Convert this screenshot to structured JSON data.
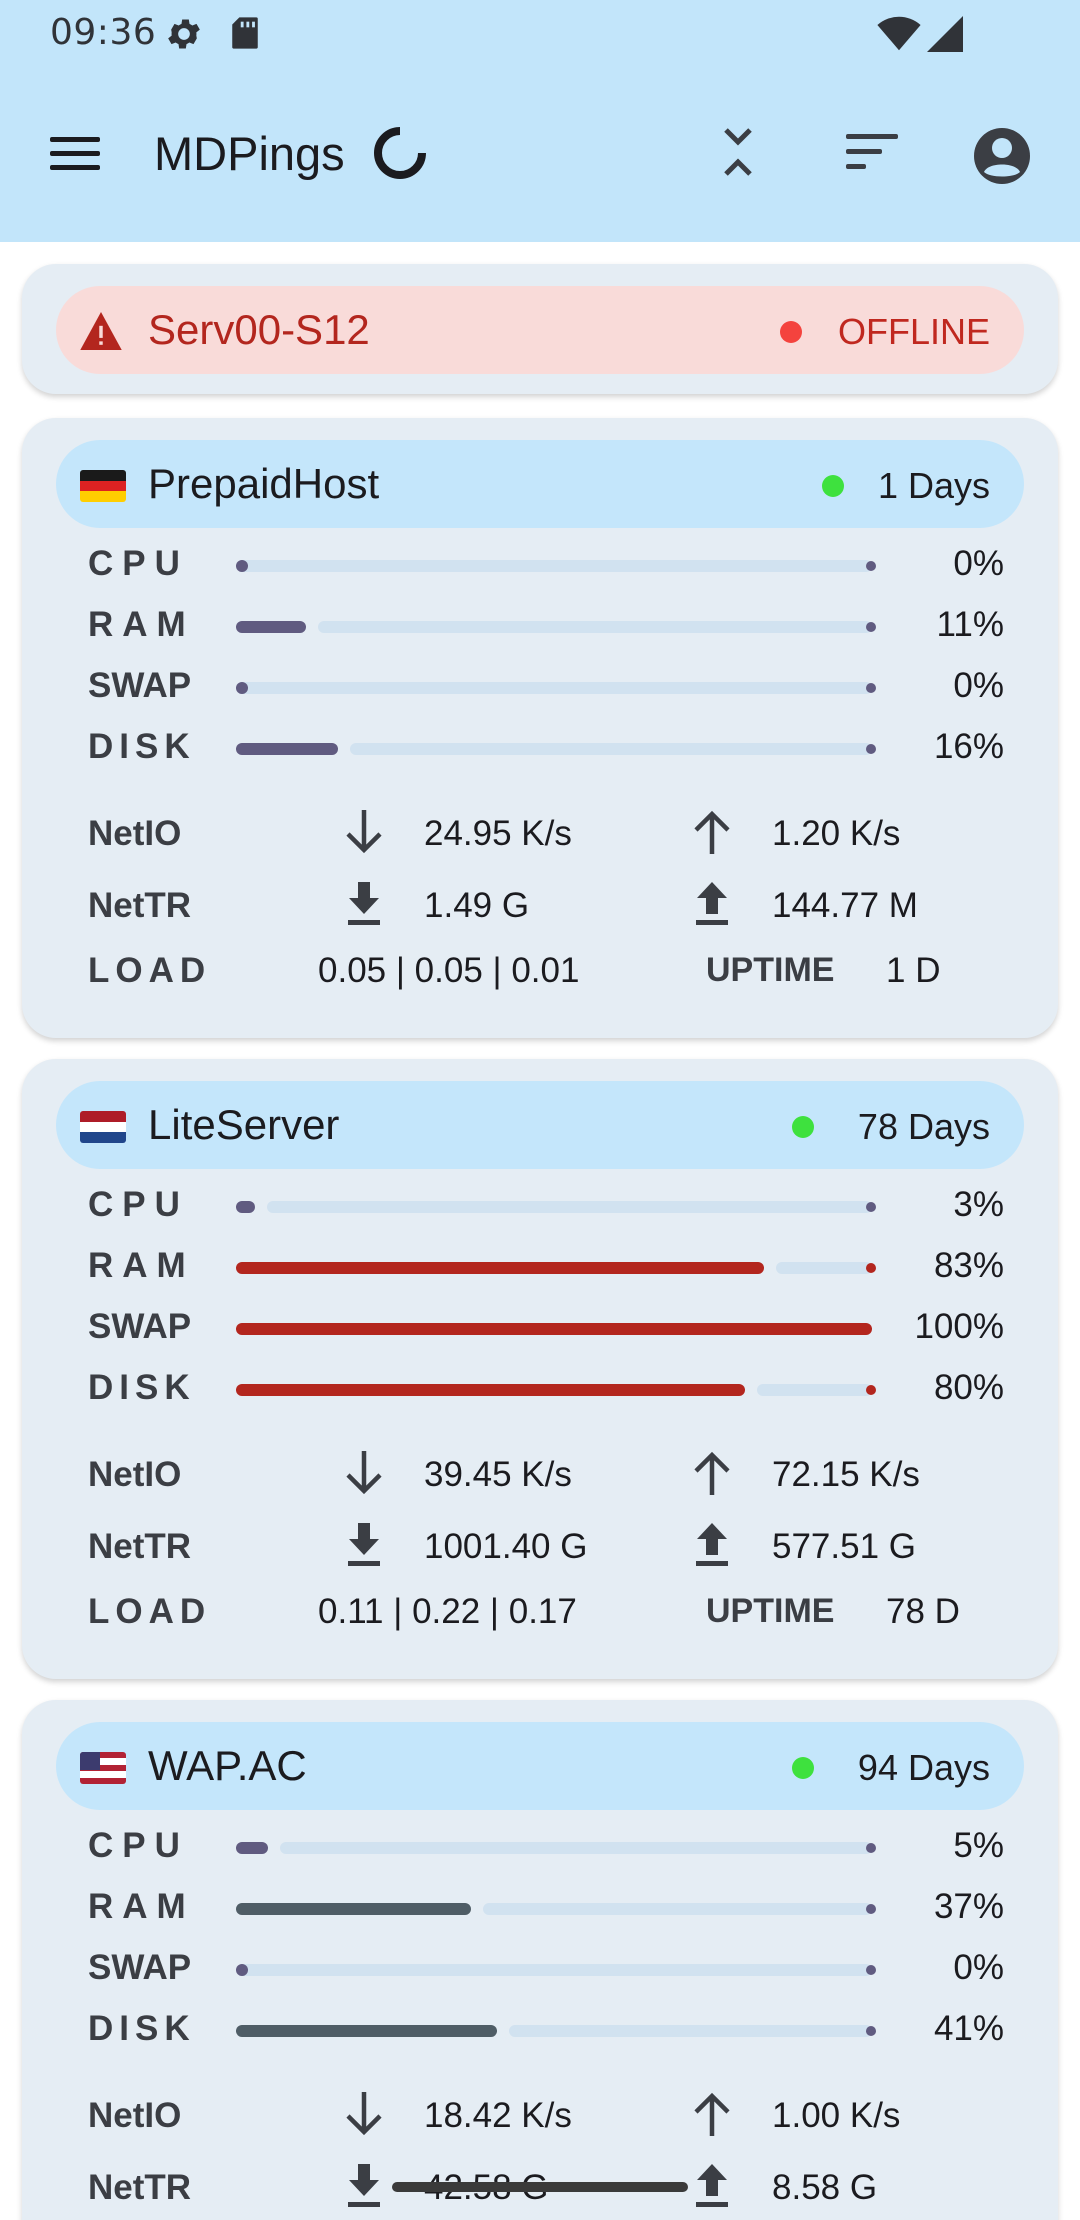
{
  "status_bar": {
    "time": "09:36"
  },
  "app_bar": {
    "title": "MDPings"
  },
  "colors": {
    "bar_bg": "#c2e5fa",
    "normal_fill": "#605b80",
    "high_fill": "#b3261e",
    "mid_fill": "#4f5d66",
    "online_dot": "#3ee13e",
    "offline_dot": "#f4433e"
  },
  "labels": {
    "cpu": "CPU",
    "ram": "RAM",
    "swap": "SWAP",
    "disk": "DISK",
    "netio": "NetIO",
    "nettr": "NetTR",
    "load": "LOAD",
    "uptime": "UPTIME"
  },
  "offline_server": {
    "name": "Serv00-S12",
    "status": "OFFLINE"
  },
  "servers": [
    {
      "name": "PrepaidHost",
      "flag": "germany-flag",
      "status": "1 Days",
      "cpu": {
        "value": 0,
        "label": "0%"
      },
      "ram": {
        "value": 11,
        "label": "11%"
      },
      "swap": {
        "value": 0,
        "label": "0%"
      },
      "disk": {
        "value": 16,
        "label": "16%"
      },
      "netio_down": "24.95 K/s",
      "netio_up": "1.20 K/s",
      "nettr_down": "1.49 G",
      "nettr_up": "144.77 M",
      "load": "0.05 | 0.05 | 0.01",
      "uptime": "1 D"
    },
    {
      "name": "LiteServer",
      "flag": "netherlands-flag",
      "status": "78 Days",
      "cpu": {
        "value": 3,
        "label": "3%"
      },
      "ram": {
        "value": 83,
        "label": "83%"
      },
      "swap": {
        "value": 100,
        "label": "100%"
      },
      "disk": {
        "value": 80,
        "label": "80%"
      },
      "netio_down": "39.45 K/s",
      "netio_up": "72.15 K/s",
      "nettr_down": "1001.40 G",
      "nettr_up": "577.51 G",
      "load": "0.11 | 0.22 | 0.17",
      "uptime": "78 D"
    },
    {
      "name": "WAP.AC",
      "flag": "usa-flag",
      "status": "94 Days",
      "cpu": {
        "value": 5,
        "label": "5%"
      },
      "ram": {
        "value": 37,
        "label": "37%"
      },
      "swap": {
        "value": 0,
        "label": "0%"
      },
      "disk": {
        "value": 41,
        "label": "41%"
      },
      "netio_down": "18.42 K/s",
      "netio_up": "1.00 K/s",
      "nettr_down": "42.58 G",
      "nettr_up": "8.58 G"
    }
  ]
}
